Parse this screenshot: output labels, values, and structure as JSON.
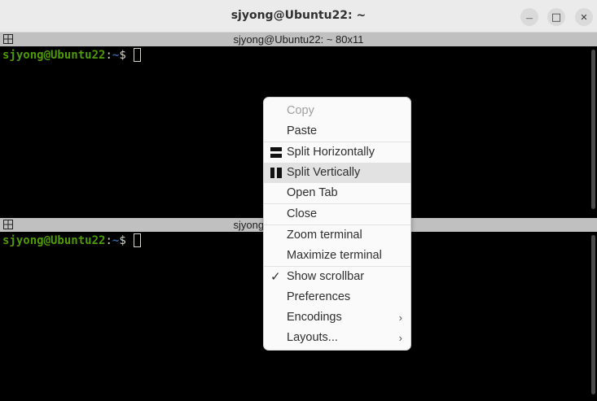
{
  "window": {
    "title": "sjyong@Ubuntu22: ~",
    "minimize_glyph": "—",
    "maximize_glyph": "□",
    "close_glyph": "✕"
  },
  "panes": [
    {
      "header_title": "sjyong@Ubuntu22: ~ 80x11",
      "prompt_user": "sjyong@Ubuntu22",
      "prompt_sep": ":",
      "prompt_path": "~",
      "prompt_symbol": "$"
    },
    {
      "header_title": "sjyong@Ubuntu22: ~ 80x11",
      "prompt_user": "sjyong@Ubuntu22",
      "prompt_sep": ":",
      "prompt_path": "~",
      "prompt_symbol": "$"
    }
  ],
  "context_menu": {
    "items": [
      {
        "label": "Copy",
        "disabled": true
      },
      {
        "label": "Paste"
      },
      {
        "label": "Split Horizontally",
        "icon": "split-horizontal-icon"
      },
      {
        "label": "Split Vertically",
        "icon": "split-vertical-icon",
        "hovered": true
      },
      {
        "label": "Open Tab"
      },
      {
        "label": "Close"
      },
      {
        "label": "Zoom terminal"
      },
      {
        "label": "Maximize terminal"
      },
      {
        "label": "Show scrollbar",
        "icon": "checkmark-icon",
        "checked": true
      },
      {
        "label": "Preferences"
      },
      {
        "label": "Encodings",
        "submenu": true
      },
      {
        "label": "Layouts...",
        "submenu": true
      }
    ],
    "submenu_glyph": "›",
    "check_glyph": "✓"
  },
  "colors": {
    "prompt_user": "#4e9a06",
    "prompt_path": "#3465a4",
    "terminal_bg": "#000000",
    "pane_header_bg": "#c0c0c0",
    "menu_hover": "#e2e2e2"
  }
}
